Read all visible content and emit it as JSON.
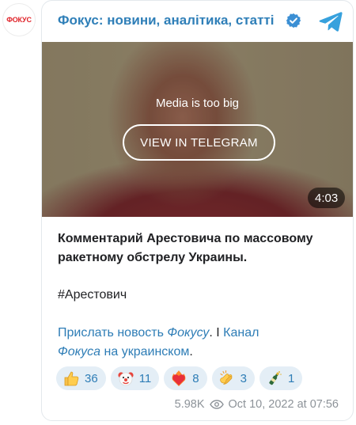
{
  "channel": {
    "avatar_text": "ФОКУС",
    "title": "Фокус: новини, аналітика, статті"
  },
  "media": {
    "note": "Media is too big",
    "button_label": "VIEW IN TELEGRAM",
    "duration": "4:03"
  },
  "post": {
    "headline": "Комментарий Арестовича по массовому ракетному обстрелу Украины.",
    "hashtag": "#Арестович",
    "link_1a": "Прислать новость ",
    "link_1b": "Фокусу",
    "separator": ". I ",
    "link_2a": "Канал",
    "link_2b": "Фокуса",
    "link_2c": " на украинском",
    "tail": "."
  },
  "reactions": [
    {
      "icon": "thumbs-up-icon",
      "count": "36"
    },
    {
      "icon": "clown-face-icon",
      "count": "11"
    },
    {
      "icon": "heart-on-fire-icon",
      "count": "8"
    },
    {
      "icon": "clapping-hands-icon",
      "count": "3"
    },
    {
      "icon": "champagne-icon",
      "count": "1"
    }
  ],
  "footer": {
    "views": "5.98K",
    "date": "Oct 10, 2022 at 07:56"
  },
  "colors": {
    "title": "#2f7fb8",
    "link": "#2e7db6",
    "reaction_bg": "#e4eef6",
    "verified": "#3b8fd4",
    "avatar_text": "#e0242a"
  }
}
